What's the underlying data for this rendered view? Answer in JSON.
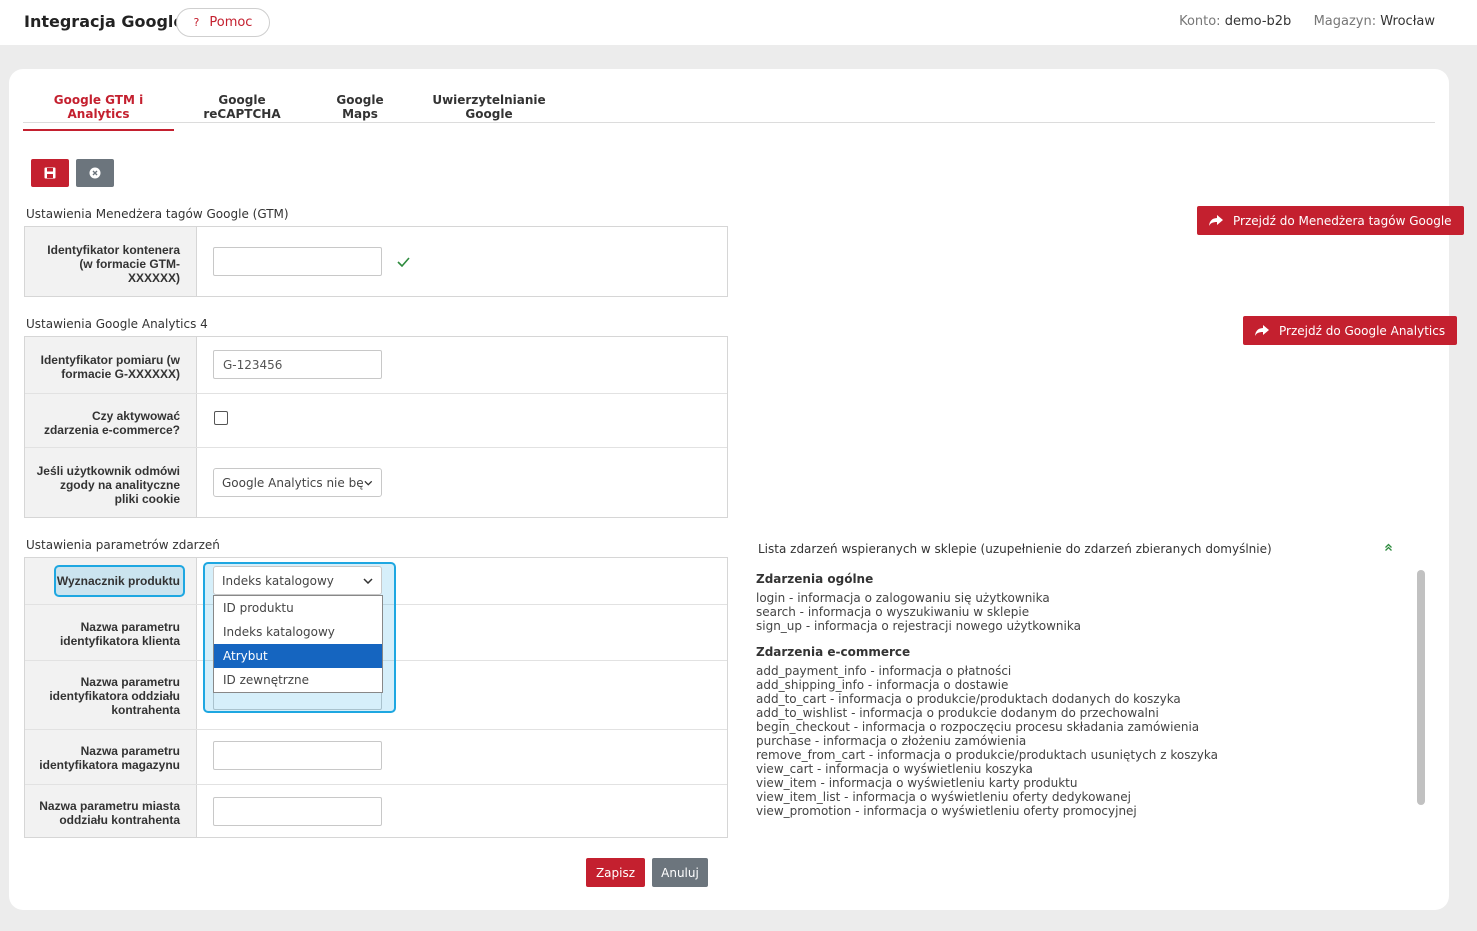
{
  "header": {
    "title": "Integracja Google",
    "help_label": "Pomoc",
    "help_icon": "?",
    "account_label": "Konto:",
    "account_value": "demo-b2b",
    "warehouse_label": "Magazyn:",
    "warehouse_value": "Wrocław"
  },
  "tabs": [
    {
      "label": "Google GTM i Analytics",
      "active": true
    },
    {
      "label": "Google reCAPTCHA",
      "active": false
    },
    {
      "label": "Google Maps",
      "active": false
    },
    {
      "label": "Uwierzytelnianie Google",
      "active": false
    }
  ],
  "toolbar": {
    "save_icon": "floppy-disk-icon",
    "cancel_icon": "circle-x-icon"
  },
  "gtm": {
    "section_label": "Ustawienia Menedżera tagów Google (GTM)",
    "container_id_label": "Identyfikator kontenera (w formacie GTM-XXXXXX)",
    "container_id_value": "",
    "valid_icon": "checkmark-icon",
    "goto_button": "Przejdź do Menedżera tagów Google"
  },
  "ga4": {
    "section_label": "Ustawienia Google Analytics 4",
    "measurement_id_label": "Identyfikator pomiaru (w formacie G-XXXXXX)",
    "measurement_id_value": "G-123456",
    "ecommerce_label": "Czy aktywować zdarzenia e-commerce?",
    "ecommerce_checked": false,
    "consent_label": "Jeśli użytkownik odmówi zgody na analityczne pliki cookie",
    "consent_value": "Google Analytics nie będzie",
    "goto_button": "Przejdź do Google Analytics"
  },
  "params": {
    "section_label": "Ustawienia parametrów zdarzeń",
    "product_id_label": "Wyznacznik produktu",
    "product_id_value": "Indeks katalogowy",
    "product_id_options": [
      "ID produktu",
      "Indeks katalogowy",
      "Atrybut",
      "ID zewnętrzne"
    ],
    "product_id_highlighted": "Atrybut",
    "client_param_label": "Nazwa parametru identyfikatora klienta",
    "branch_param_label": "Nazwa parametru identyfikatora oddziału kontrahenta",
    "warehouse_param_label": "Nazwa parametru identyfikatora magazynu",
    "city_param_label": "Nazwa parametru miasta oddziału kontrahenta"
  },
  "events": {
    "title": "Lista zdarzeń wspieranych w sklepie (uzupełnienie do zdarzeń zbieranych domyślnie)",
    "collapse_icon": "double-chevron-up-icon",
    "general_title": "Zdarzenia ogólne",
    "general": [
      "login - informacja o zalogowaniu się użytkownika",
      "search - informacja o wyszukiwaniu w sklepie",
      "sign_up - informacja o rejestracji nowego użytkownika"
    ],
    "ecommerce_title": "Zdarzenia e-commerce",
    "ecommerce": [
      "add_payment_info - informacja o płatności",
      "add_shipping_info - informacja o dostawie",
      "add_to_cart - informacja o produkcie/produktach dodanych do koszyka",
      "add_to_wishlist - informacja o produkcie dodanym do przechowalni",
      "begin_checkout - informacja o rozpoczęciu procesu składania zamówienia",
      "purchase - informacja o złożeniu zamówienia",
      "remove_from_cart - informacja o produkcie/produktach usuniętych z koszyka",
      "view_cart - informacja o wyświetleniu koszyka",
      "view_item - informacja o wyświetleniu karty produktu",
      "view_item_list - informacja o wyświetleniu oferty dedykowanej",
      "view_promotion - informacja o wyświetleniu oferty promocyjnej"
    ]
  },
  "footer": {
    "save_label": "Zapisz",
    "cancel_label": "Anuluj"
  },
  "colors": {
    "accent": "#c4202f",
    "secondary": "#6c757d",
    "focus": "#1ea7e1",
    "selected_option": "#1565c0",
    "success": "#2e8b3e"
  }
}
